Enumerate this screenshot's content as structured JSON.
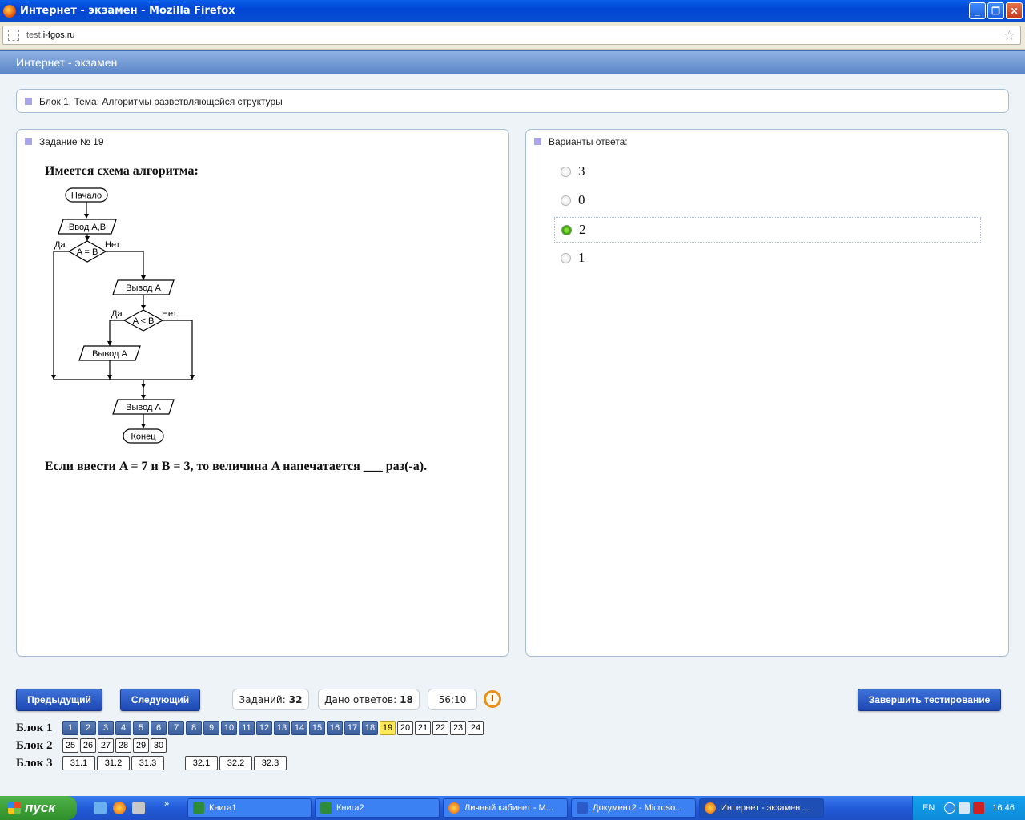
{
  "window": {
    "title": "Интернет - экзамен - Mozilla Firefox"
  },
  "urlbar": {
    "domain_prefix": "test.",
    "domain_main": "i-fgos.ru"
  },
  "app": {
    "header": "Интернет - экзамен"
  },
  "block_info": {
    "label": "Блок 1. Тема: Алгоритмы разветвляющейся структуры"
  },
  "task": {
    "label": "Задание № 19",
    "title": "Имеется схема алгоритма:",
    "question": "Если ввести A = 7 и B = 3, то величина A напечатается ___ раз(-а).",
    "flowchart": {
      "start": "Начало",
      "input": "Ввод A,B",
      "cond1": "A = B",
      "yes": "Да",
      "no": "Нет",
      "output": "Вывод  A",
      "cond2": "A < B",
      "end": "Конец"
    }
  },
  "answers": {
    "label": "Варианты ответа:",
    "options": [
      {
        "text": "3",
        "selected": false
      },
      {
        "text": "0",
        "selected": false
      },
      {
        "text": "2",
        "selected": true
      },
      {
        "text": "1",
        "selected": false
      }
    ]
  },
  "controls": {
    "prev": "Предыдущий",
    "next": "Следующий",
    "tasks_label": "Заданий:",
    "tasks_value": "32",
    "answered_label": "Дано ответов:",
    "answered_value": "18",
    "timer": "56:10",
    "finish": "Завершить тестирование"
  },
  "blocks": [
    {
      "label": "Блок 1",
      "items": [
        "1",
        "2",
        "3",
        "4",
        "5",
        "6",
        "7",
        "8",
        "9",
        "10",
        "11",
        "12",
        "13",
        "14",
        "15",
        "16",
        "17",
        "18",
        "19",
        "20",
        "21",
        "22",
        "23",
        "24"
      ],
      "answered_count": 18,
      "current": "19"
    },
    {
      "label": "Блок 2",
      "items": [
        "25",
        "26",
        "27",
        "28",
        "29",
        "30"
      ]
    },
    {
      "label": "Блок 3",
      "items": [
        "31.1",
        "31.2",
        "31.3",
        "32.1",
        "32.2",
        "32.3"
      ]
    }
  ],
  "taskbar": {
    "start": "пуск",
    "tasks": [
      "Книга1",
      "Книга2",
      "Личный кабинет - M...",
      "Документ2 - Microso...",
      "Интернет - экзамен ..."
    ],
    "lang": "EN",
    "time": "16:46"
  },
  "colors": {
    "accent": "#1d48b4",
    "selected_radio": "#2f9a00",
    "current_task": "#ffe85a",
    "answered_task": "#3b5e9e"
  }
}
